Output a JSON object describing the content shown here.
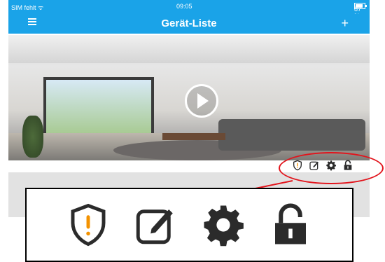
{
  "status_bar": {
    "carrier": "SIM fehlt ᯤ",
    "time": "09:05",
    "battery": "87 %"
  },
  "nav_bar": {
    "title": "Gerät-Liste",
    "menu_icon": "hamburger-menu-icon",
    "add_label": "+"
  },
  "device": {
    "preview_icon": "play-icon",
    "action_icons": [
      "alarm-shield-icon",
      "edit-icon",
      "settings-gear-icon",
      "unlock-icon"
    ]
  },
  "colors": {
    "header": "#1aa3e8",
    "highlight": "#e2141c",
    "alarm": "#f39200",
    "icon": "#2b2b2b"
  }
}
